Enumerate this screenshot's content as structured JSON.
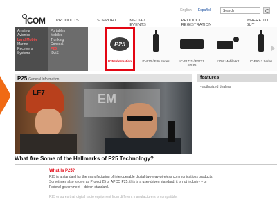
{
  "header": {
    "brand": "ICOM",
    "lang_english": "English",
    "lang_separator": "|",
    "lang_espanol": "Español",
    "search_value": "Search"
  },
  "nav": {
    "products": "PRODUCTS",
    "support": "SUPPORT",
    "media": "MEDIA / EVENTS",
    "registration": "PRODUCT REGISTRATION",
    "where": "WHERE TO BUY"
  },
  "categories": {
    "left": [
      "Amateur",
      "Avionics",
      "Land Mobile",
      "Marine",
      "Receivers",
      "Systems"
    ],
    "left_active": "Land Mobile",
    "right": [
      "Portables",
      "Mobiles",
      "Trunking",
      "Conceal.",
      "P25",
      "IDAS"
    ],
    "right_active": "P25"
  },
  "tiles": [
    {
      "badge": "P25",
      "caption": "P25 Information",
      "selected": true
    },
    {
      "caption": "IC-F70 / F80 Series"
    },
    {
      "caption": "IC-F1721 / F2721 Series"
    },
    {
      "caption": "110W Mobile Kit"
    },
    {
      "caption": "IC-F9011 Series"
    }
  ],
  "section": {
    "title": "P25",
    "subtitle": "General Information",
    "hero_helmet_text": "LF7",
    "hero_truck_text": "EM"
  },
  "features": {
    "title": "features",
    "items": [
      "- authorized dealers"
    ]
  },
  "content": {
    "heading": "What Are Some of the Hallmarks of P25 Technology?",
    "subheading": "What is P25?",
    "line1": "P25 is a standard for the manufacturing of interoperable digital two-way wireless communications products.",
    "line2": "Sometimes also known as Project 25 or APCO P25, this is a user-driven standard, it is not industry – or",
    "line3": "Federal government – driven standard.",
    "faded": "P25 ensures that digital radio equipment from different manufacturers is compatible."
  },
  "colors": {
    "accent_red": "#e30613",
    "arrow_orange": "#f06a14",
    "menu_dark": "#4d4d4d",
    "menu_mid": "#6c6c6c"
  }
}
